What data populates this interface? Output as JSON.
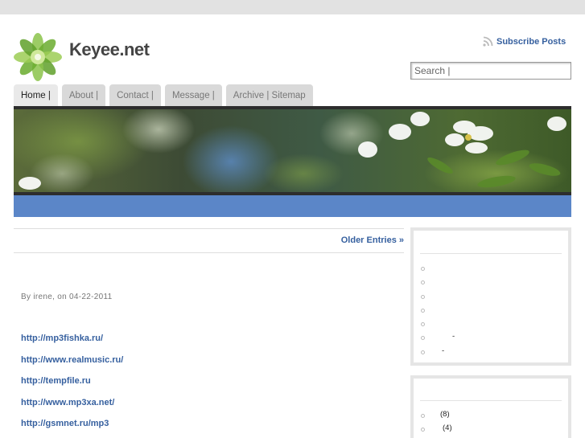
{
  "site": {
    "title": "Keyee.net",
    "logo_icon": "green-flower-logo-icon"
  },
  "header": {
    "subscribe_label": "Subscribe Posts",
    "rss_icon": "rss-icon",
    "search_placeholder": "Search |"
  },
  "nav": {
    "tabs": [
      "Home |",
      "About |",
      "Contact |",
      "Message |",
      "Archive | Sitemap"
    ],
    "active": "Home |"
  },
  "colors": {
    "link": "#36609f",
    "banner_bar": "#5b86c8",
    "tab_bg": "#d9d9d9"
  },
  "pagination": {
    "older_label": "Older Entries »"
  },
  "post": {
    "meta": "By irene, on 04-22-2011",
    "links": [
      "http://mp3fishka.ru/",
      "http://www.realmusic.ru/",
      "http://tempfile.ru",
      "http://www.mp3xa.net/",
      "http://gsmnet.ru/mp3"
    ]
  },
  "sidebar": {
    "box1_items": [
      "",
      "",
      "",
      "",
      "",
      "-",
      "-"
    ],
    "box2_items": [
      "(8)",
      "(4)"
    ]
  }
}
